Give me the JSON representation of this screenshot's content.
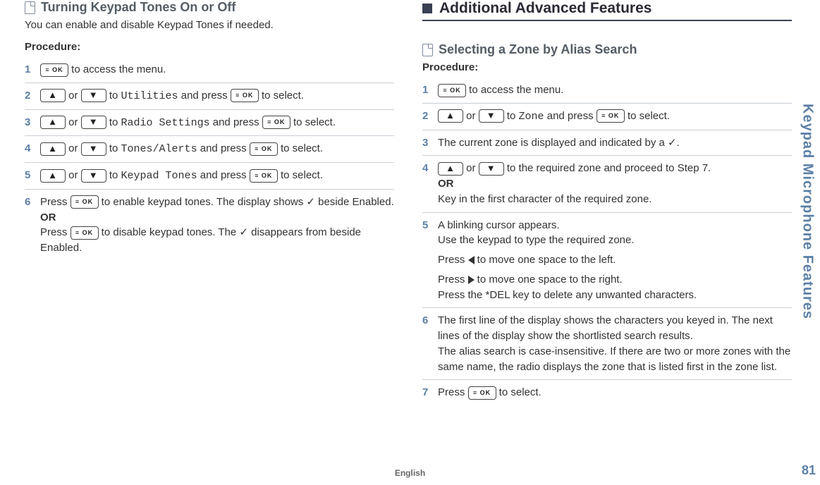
{
  "sideTab": "Keypad Microphone Features",
  "pageNumber": "81",
  "footerLang": "English",
  "keys": {
    "ok": "≡ OK",
    "up": "▲",
    "down": "▼"
  },
  "left": {
    "title": "Turning Keypad Tones On or Off",
    "intro": "You can enable and disable Keypad Tones if needed.",
    "procLabel": "Procedure:",
    "steps": [
      {
        "num": "1",
        "pre": "",
        "key1": "ok",
        "post": " to access the menu."
      },
      {
        "num": "2",
        "key1": "up",
        "mid": " or ",
        "key2": "down",
        "to": " to ",
        "mono": "Utilities",
        "post2": " and press ",
        "key3": "ok",
        "post3": " to select."
      },
      {
        "num": "3",
        "key1": "up",
        "mid": " or ",
        "key2": "down",
        "to": " to ",
        "mono": "Radio Settings",
        "post2": " and press ",
        "key3": "ok",
        "post3": " to select."
      },
      {
        "num": "4",
        "key1": "up",
        "mid": " or ",
        "key2": "down",
        "to": " to ",
        "mono": "Tones/Alerts",
        "post2": " and press ",
        "key3": "ok",
        "post3": " to select."
      },
      {
        "num": "5",
        "key1": "up",
        "mid": " or ",
        "key2": "down",
        "to": " to ",
        "mono": "Keypad Tones",
        "post2": " and press ",
        "key3": "ok",
        "post3": " to select."
      },
      {
        "num": "6",
        "line1a": "Press ",
        "key1": "ok",
        "line1b": " to enable keypad tones. The display shows ✓ beside Enabled.",
        "or": "OR",
        "line2a": "Press ",
        "key2": "ok",
        "line2b": " to disable keypad tones. The ✓ disappears from beside Enabled."
      }
    ]
  },
  "right": {
    "heading": "Additional Advanced Features",
    "sub": "Selecting a Zone by Alias Search",
    "procLabel": "Procedure:",
    "steps": {
      "s1": {
        "num": "1",
        "key1": "ok",
        "text": " to access the menu."
      },
      "s2": {
        "num": "2",
        "key1": "up",
        "mid": " or ",
        "key2": "down",
        "to": " to ",
        "mono": "Zone",
        "post2": " and press ",
        "key3": "ok",
        "post3": " to select."
      },
      "s3": {
        "num": "3",
        "text": "The current zone is displayed and indicated by a ✓."
      },
      "s4": {
        "num": "4",
        "key1": "up",
        "mid": " or ",
        "key2": "down",
        "text": " to the required zone and proceed to Step 7.",
        "or": "OR",
        "text2": "Key in the first character of the required zone."
      },
      "s5": {
        "num": "5",
        "l1": "A blinking cursor appears.",
        "l2": "Use the keypad to type the required zone.",
        "l3a": "Press ",
        "l3b": " to move one space to the left.",
        "l4a": "Press ",
        "l4b": " to move one space to the right.",
        "l5": "Press the *DEL key to delete any unwanted characters."
      },
      "s6": {
        "num": "6",
        "l1": "The first line of the display shows the characters you keyed in. The next lines of the display show the shortlisted search results.",
        "l2": "The alias search is case-insensitive. If there are two or more zones with the same name, the radio displays the zone that is listed first in the zone list."
      },
      "s7": {
        "num": "7",
        "pre": "Press ",
        "key1": "ok",
        "post": " to select."
      }
    }
  }
}
